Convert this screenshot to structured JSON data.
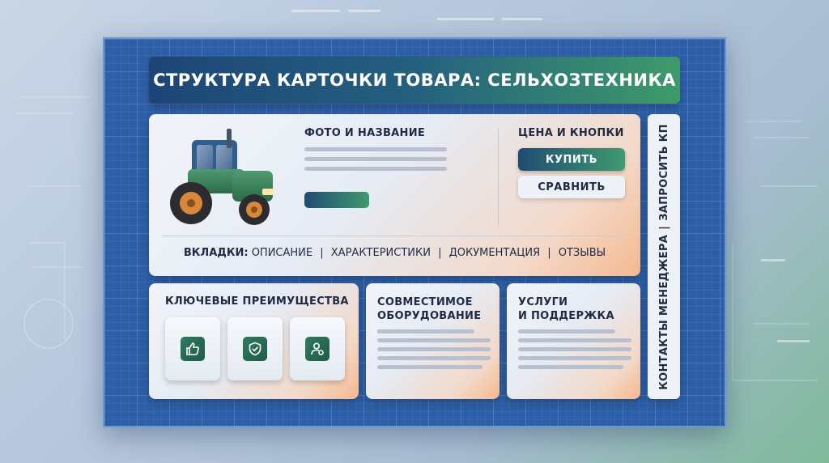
{
  "title": "СТРУКТУРА КАРТОЧКИ ТОВАРА: СЕЛЬХОЗТЕХНИКА",
  "main_card": {
    "photo_heading": "ФОТО И НАЗВАНИЕ",
    "price_heading": "ЦЕНА И КНОПКИ",
    "buy_label": "КУПИТЬ",
    "compare_label": "СРАВНИТЬ",
    "tabs_lead": "ВКЛАДКИ:",
    "tabs": [
      "ОПИСАНИЕ",
      "ХАРАКТЕРИСТИКИ",
      "ДОКУМЕНТАЦИЯ",
      "ОТЗЫВЫ"
    ],
    "tab_separator": "|"
  },
  "advantages": {
    "heading": "КЛЮЧЕВЫЕ ПРЕИМУЩЕСТВА",
    "icons": [
      "thumbs-up-icon",
      "shield-check-icon",
      "user-settings-icon"
    ]
  },
  "compatible": {
    "heading_line1": "СОВМЕСТИМОЕ",
    "heading_line2": "ОБОРУДОВАНИЕ"
  },
  "services": {
    "heading_line1": "УСЛУГИ",
    "heading_line2": "И ПОДДЕРЖКА"
  },
  "side_panel": {
    "contacts": "КОНТАКТЫ МЕНЕДЖЕРА",
    "separator": "|",
    "request": "ЗАПРОСИТЬ КП"
  },
  "colors": {
    "accent_dark": "#1f4c72",
    "accent_green": "#3f9a70",
    "board_blue": "#2d5fa8"
  }
}
